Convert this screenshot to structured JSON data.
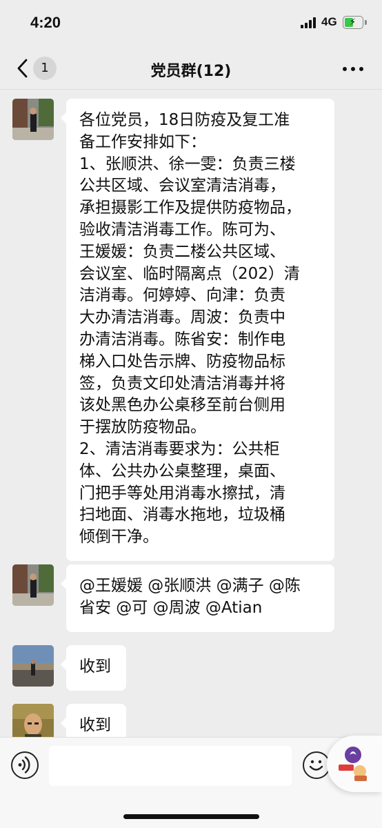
{
  "status_bar": {
    "time": "4:20",
    "network": "4G"
  },
  "nav": {
    "unread_count": "1",
    "title": "党员群(12)"
  },
  "messages": [
    {
      "avatar": "street-photo-avatar",
      "text": "各位党员，18日防疫及复工准\n备工作安排如下：\n1、张顺洪、徐一雯：负责三楼\n公共区域、会议室清洁消毒，\n承担摄影工作及提供防疫物品，\n验收清洁消毒工作。陈可为、\n王媛媛：负责二楼公共区域、\n会议室、临时隔离点（202）清\n洁消毒。何婷婷、向津：负责\n大办清洁消毒。周波：负责中\n办清洁消毒。陈省安：制作电\n梯入口处告示牌、防疫物品标\n签，负责文印处清洁消毒并将\n该处黑色办公桌移至前台侧用\n于摆放防疫物品。\n2、清洁消毒要求为：公共柜\n体、公共办公桌整理，桌面、\n门把手等处用消毒水擦拭，清\n扫地面、消毒水拖地，垃圾桶\n倾倒干净。"
    },
    {
      "avatar": "street-photo-avatar",
      "text": "@王媛媛 @张顺洪 @满子 @陈\n省安 @可 @周波 @Atian"
    },
    {
      "avatar": "road-photo-avatar",
      "text": "收到"
    },
    {
      "avatar": "portrait-photo-avatar",
      "text": "收到"
    }
  ],
  "input_bar": {
    "placeholder": ""
  },
  "colors": {
    "background": "#ededed",
    "bubble": "#ffffff",
    "battery": "#3bc74b"
  }
}
